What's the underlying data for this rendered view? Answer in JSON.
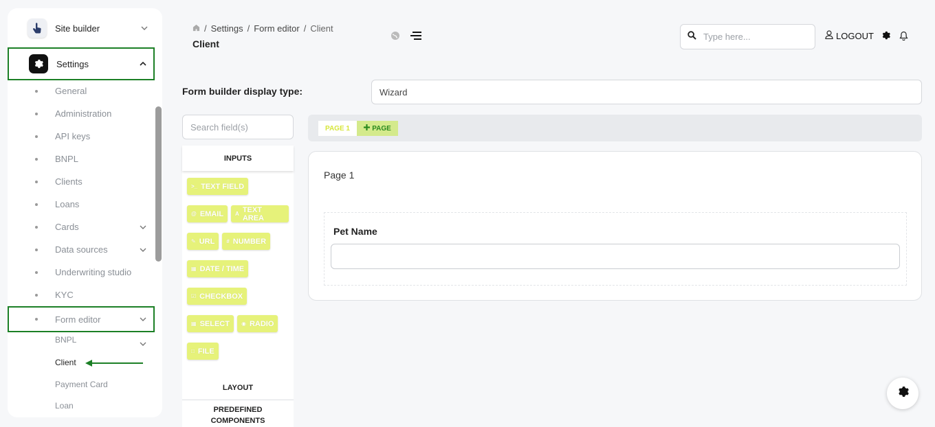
{
  "sidebar": {
    "site_builder": "Site builder",
    "settings": "Settings",
    "items": [
      {
        "label": "General",
        "chevron": false
      },
      {
        "label": "Administration",
        "chevron": false
      },
      {
        "label": "API keys",
        "chevron": false
      },
      {
        "label": "BNPL",
        "chevron": false
      },
      {
        "label": "Clients",
        "chevron": false
      },
      {
        "label": "Loans",
        "chevron": false
      },
      {
        "label": "Cards",
        "chevron": true
      },
      {
        "label": "Data sources",
        "chevron": true
      },
      {
        "label": "Underwriting studio",
        "chevron": false
      },
      {
        "label": "KYC",
        "chevron": false
      },
      {
        "label": "Form editor",
        "chevron": true
      }
    ],
    "form_editor_items": [
      "BNPL",
      "Client",
      "Payment Card",
      "Loan"
    ]
  },
  "header": {
    "breadcrumb": [
      "Settings",
      "Form editor",
      "Client"
    ],
    "title": "Client",
    "search_placeholder": "Type here...",
    "logout": "LOGOUT"
  },
  "form_builder": {
    "display_type_label": "Form builder display type:",
    "display_type_value": "Wizard",
    "field_search_placeholder": "Search field(s)",
    "inputs_header": "INPUTS",
    "chips": [
      [
        "TEXT FIELD"
      ],
      [
        "EMAIL",
        "TEXT AREA"
      ],
      [
        "URL",
        "NUMBER"
      ],
      [
        "DATE / TIME"
      ],
      [
        "CHECKBOX"
      ],
      [
        "SELECT",
        "RADIO"
      ],
      [
        "FILE"
      ]
    ],
    "layout_header": "LAYOUT",
    "predefined_header": "PREDEFINED COMPONENTS",
    "tab_page1": "PAGE 1",
    "tab_add": "PAGE",
    "page_title": "Page 1",
    "field_label": "Pet Name"
  },
  "colors": {
    "accent_green": "#1b7f25",
    "chip_yellow": "#e6f27a"
  }
}
